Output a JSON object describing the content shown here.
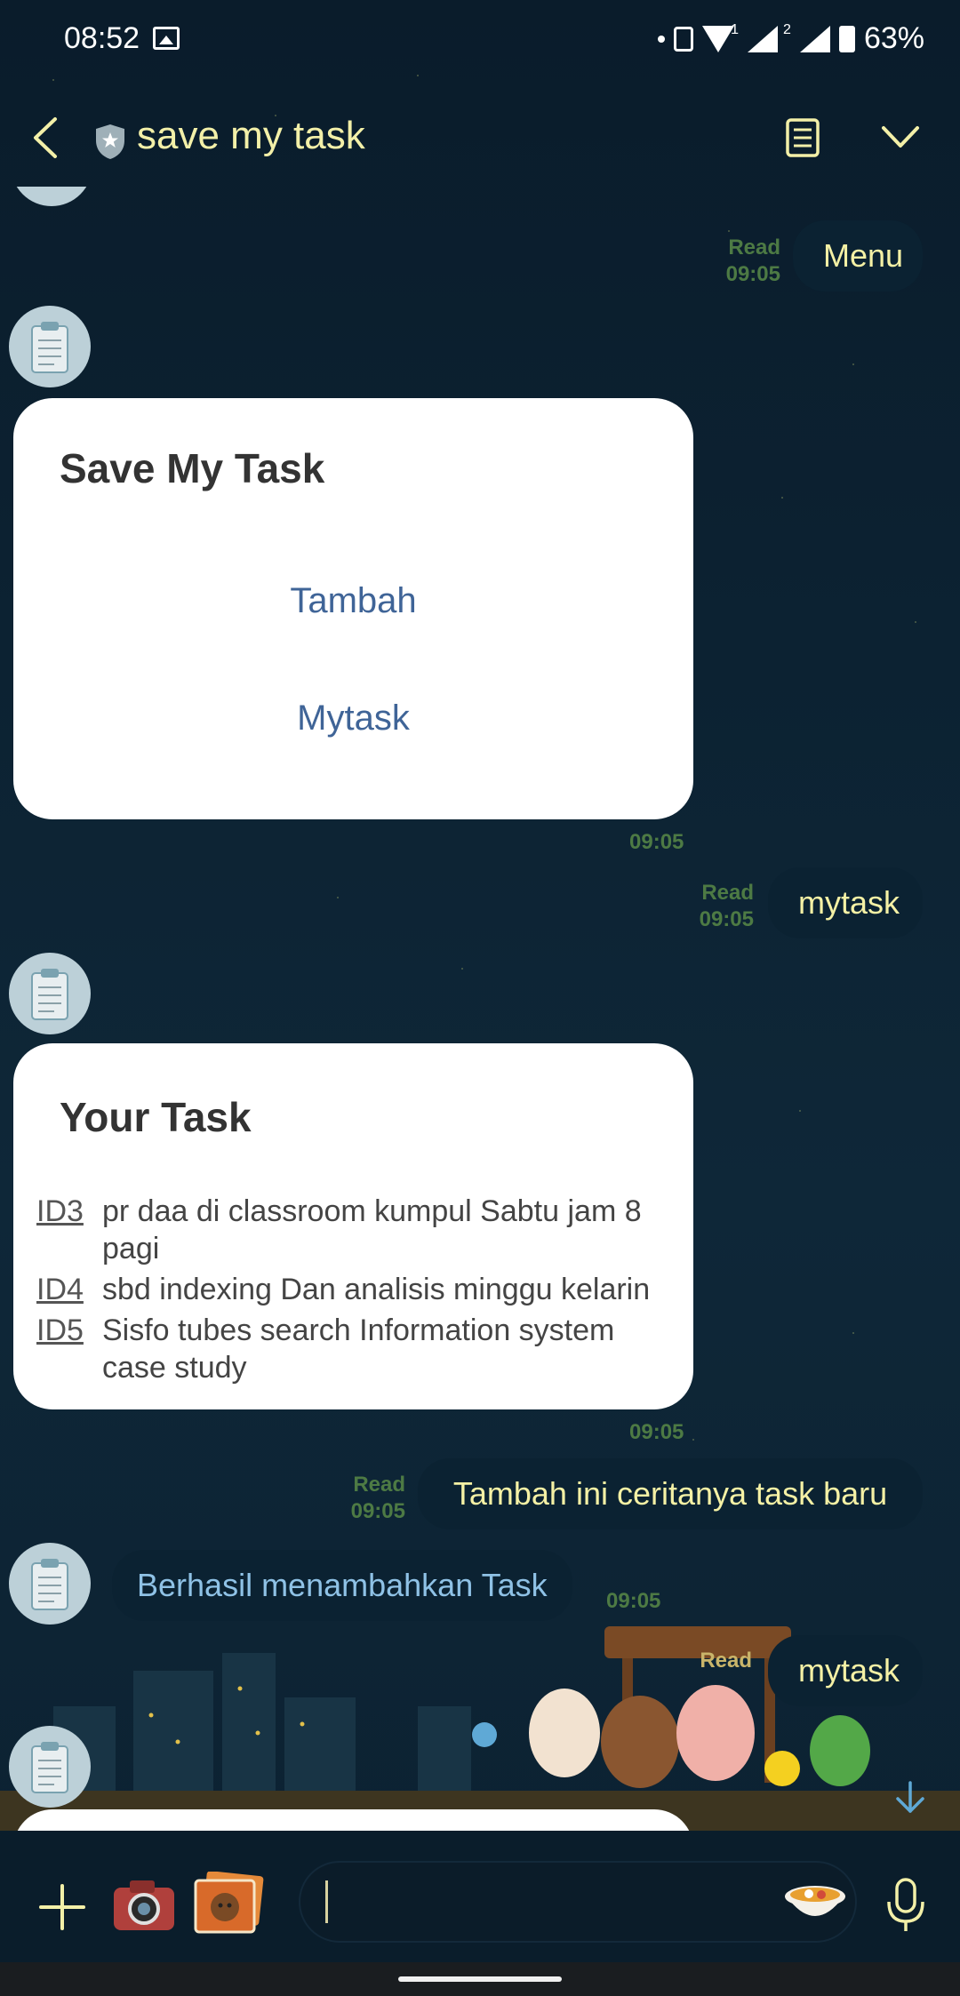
{
  "status_bar": {
    "time": "08:52",
    "battery": "63%",
    "sim1_badge": "1",
    "sim2_badge": "2"
  },
  "header": {
    "title": "save my task"
  },
  "messages": {
    "menu_out": {
      "text": "Menu",
      "read": "Read",
      "time": "09:05"
    },
    "menu_card": {
      "title": "Save My Task",
      "actions": [
        "Tambah",
        "Mytask"
      ],
      "time": "09:05"
    },
    "mytask_out": {
      "text": "mytask",
      "read": "Read",
      "time": "09:05"
    },
    "task_card": {
      "title": "Your Task",
      "tasks": [
        {
          "id": "ID3",
          "line1": "pr daa di classroom kumpul Sabtu jam 8",
          "line2": "pagi"
        },
        {
          "id": "ID4",
          "line1": "sbd indexing Dan analisis minggu kelarin",
          "line2": ""
        },
        {
          "id": "ID5",
          "line1": "Sisfo tubes search Information system",
          "line2": "case study"
        }
      ],
      "time": "09:05"
    },
    "tambah_out": {
      "text": "Tambah ini ceritanya task baru",
      "read": "Read",
      "time": "09:05"
    },
    "success_in": {
      "text": "Berhasil menambahkan Task",
      "time": "09:05"
    },
    "mytask_out2": {
      "text": "mytask",
      "read": "Read"
    }
  },
  "colors": {
    "outgoing_text": "#f5f1a5",
    "incoming_text": "#8fc2e6",
    "meta_text": "#4d7a44",
    "card_action": "#3f6497",
    "background": "#0c2233"
  },
  "icons": {
    "back": "chevron-left-icon",
    "shield": "shield-star-icon",
    "notes": "notes-icon",
    "collapse": "chevron-down-icon",
    "plus": "plus-icon",
    "camera": "camera-icon",
    "gallery": "gallery-icon",
    "sticker": "sticker-icon",
    "mic": "mic-icon"
  }
}
